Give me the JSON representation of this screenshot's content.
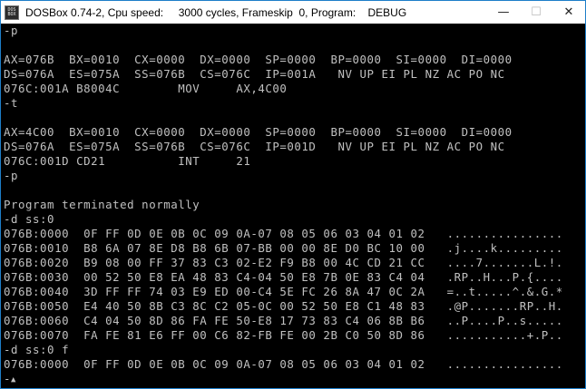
{
  "window": {
    "title": "DOSBox 0.74-2, Cpu speed:     3000 cycles, Frameskip  0, Program:    DEBUG",
    "icon_label_top": "DOS",
    "icon_label_bottom": "BOX",
    "controls": {
      "minimize": "—",
      "maximize": "☐",
      "close": "✕"
    }
  },
  "console": {
    "lines": [
      "-p",
      "",
      "AX=076B  BX=0010  CX=0000  DX=0000  SP=0000  BP=0000  SI=0000  DI=0000",
      "DS=076A  ES=075A  SS=076B  CS=076C  IP=001A   NV UP EI PL NZ AC PO NC",
      "076C:001A B8004C        MOV     AX,4C00",
      "-t",
      "",
      "AX=4C00  BX=0010  CX=0000  DX=0000  SP=0000  BP=0000  SI=0000  DI=0000",
      "DS=076A  ES=075A  SS=076B  CS=076C  IP=001D   NV UP EI PL NZ AC PO NC",
      "076C:001D CD21          INT     21",
      "-p",
      "",
      "Program terminated normally",
      "-d ss:0",
      "076B:0000  0F FF 0D 0E 0B 0C 09 0A-07 08 05 06 03 04 01 02   ................",
      "076B:0010  B8 6A 07 8E D8 B8 6B 07-BB 00 00 8E D0 BC 10 00   .j....k.........",
      "076B:0020  B9 08 00 FF 37 83 C3 02-E2 F9 B8 00 4C CD 21 CC   ....7.......L.!.",
      "076B:0030  00 52 50 E8 EA 48 83 C4-04 50 E8 7B 0E 83 C4 04   .RP..H...P.{....",
      "076B:0040  3D FF FF 74 03 E9 ED 00-C4 5E FC 26 8A 47 0C 2A   =..t.....^.&.G.*",
      "076B:0050  E4 40 50 8B C3 8C C2 05-0C 00 52 50 E8 C1 48 83   .@P.......RP..H.",
      "076B:0060  C4 04 50 8D 86 FA FE 50-E8 17 73 83 C4 06 8B B6   ..P....P..s.....",
      "076B:0070  FA FE 81 E6 FF 00 C6 82-FB FE 00 2B C0 50 8D 86   ...........+.P..",
      "-d ss:0 f",
      "076B:0000  0F FF 0D 0E 0B 0C 09 0A-07 08 05 06 03 04 01 02   ................"
    ],
    "prompt": "-",
    "cursor_glyph": "▲"
  }
}
